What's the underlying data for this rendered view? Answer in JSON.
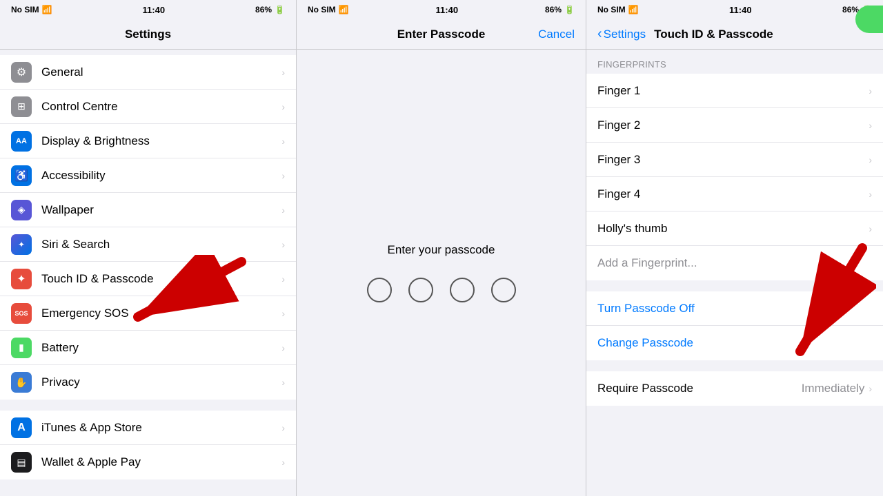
{
  "statusBar": {
    "noSim": "No SIM",
    "wifi": "wifi",
    "time": "11:40",
    "battery": "86%"
  },
  "panel1": {
    "title": "Settings",
    "items": [
      {
        "id": "general",
        "label": "General",
        "iconClass": "icon-general",
        "iconChar": "⚙"
      },
      {
        "id": "control-centre",
        "label": "Control Centre",
        "iconClass": "icon-control",
        "iconChar": "◎"
      },
      {
        "id": "display",
        "label": "Display & Brightness",
        "iconClass": "icon-display",
        "iconChar": "AA"
      },
      {
        "id": "accessibility",
        "label": "Accessibility",
        "iconClass": "icon-accessibility",
        "iconChar": "♿"
      },
      {
        "id": "wallpaper",
        "label": "Wallpaper",
        "iconClass": "icon-wallpaper",
        "iconChar": "🖼"
      },
      {
        "id": "siri",
        "label": "Siri & Search",
        "iconClass": "icon-siri",
        "iconChar": "◈"
      },
      {
        "id": "touchid",
        "label": "Touch ID & Passcode",
        "iconClass": "icon-touchid",
        "iconChar": "✦"
      },
      {
        "id": "sos",
        "label": "Emergency SOS",
        "iconClass": "icon-sos",
        "iconChar": "SOS"
      },
      {
        "id": "battery",
        "label": "Battery",
        "iconClass": "icon-battery",
        "iconChar": "▮"
      },
      {
        "id": "privacy",
        "label": "Privacy",
        "iconClass": "icon-privacy",
        "iconChar": "✋"
      }
    ],
    "items2": [
      {
        "id": "itunes",
        "label": "iTunes & App Store",
        "iconClass": "icon-itunes",
        "iconChar": "A"
      },
      {
        "id": "wallet",
        "label": "Wallet & Apple Pay",
        "iconClass": "icon-wallet",
        "iconChar": "▤"
      }
    ]
  },
  "panel2": {
    "title": "Enter Passcode",
    "cancelLabel": "Cancel",
    "promptText": "Enter your passcode",
    "dots": 4
  },
  "panel3": {
    "backLabel": "Settings",
    "title": "Touch ID & Passcode",
    "sectionHeader": "FINGERPRINTS",
    "fingerprints": [
      "Finger 1",
      "Finger 2",
      "Finger 3",
      "Finger 4",
      "Holly's thumb"
    ],
    "addFingerprint": "Add a Fingerprint...",
    "turnPasscodeOff": "Turn Passcode Off",
    "changePasscode": "Change Passcode",
    "requirePasscode": "Require Passcode",
    "requirePasscodeValue": "Immediately"
  }
}
